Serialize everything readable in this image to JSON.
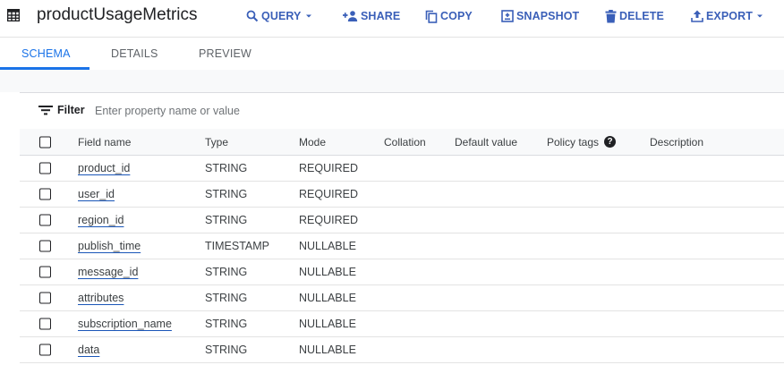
{
  "header": {
    "title": "productUsageMetrics",
    "icon": "table-icon",
    "actions": [
      {
        "id": "query",
        "label": "QUERY",
        "icon": "search-icon",
        "dropdown": true
      },
      {
        "id": "share",
        "label": "SHARE",
        "icon": "person-add-icon",
        "dropdown": false
      },
      {
        "id": "copy",
        "label": "COPY",
        "icon": "copy-icon",
        "dropdown": false
      },
      {
        "id": "snapshot",
        "label": "SNAPSHOT",
        "icon": "snapshot-icon",
        "dropdown": false
      },
      {
        "id": "delete",
        "label": "DELETE",
        "icon": "trash-icon",
        "dropdown": false
      },
      {
        "id": "export",
        "label": "EXPORT",
        "icon": "upload-icon",
        "dropdown": true
      }
    ]
  },
  "tabs": [
    {
      "label": "SCHEMA",
      "active": true
    },
    {
      "label": "DETAILS",
      "active": false
    },
    {
      "label": "PREVIEW",
      "active": false
    }
  ],
  "filter": {
    "label": "Filter",
    "placeholder": "Enter property name or value"
  },
  "table": {
    "columns": [
      "Field name",
      "Type",
      "Mode",
      "Collation",
      "Default value",
      "Policy tags",
      "Description"
    ],
    "policy_tags_help": "?",
    "rows": [
      {
        "name": "product_id",
        "type": "STRING",
        "mode": "REQUIRED"
      },
      {
        "name": "user_id",
        "type": "STRING",
        "mode": "REQUIRED"
      },
      {
        "name": "region_id",
        "type": "STRING",
        "mode": "REQUIRED"
      },
      {
        "name": "publish_time",
        "type": "TIMESTAMP",
        "mode": "NULLABLE"
      },
      {
        "name": "message_id",
        "type": "STRING",
        "mode": "NULLABLE"
      },
      {
        "name": "attributes",
        "type": "STRING",
        "mode": "NULLABLE"
      },
      {
        "name": "subscription_name",
        "type": "STRING",
        "mode": "NULLABLE"
      },
      {
        "name": "data",
        "type": "STRING",
        "mode": "NULLABLE"
      }
    ]
  },
  "colors": {
    "accent": "#1a73e8",
    "action": "#3a5fb8",
    "link": "#1a56b8",
    "text": "#202124",
    "muted": "#5f6368"
  }
}
